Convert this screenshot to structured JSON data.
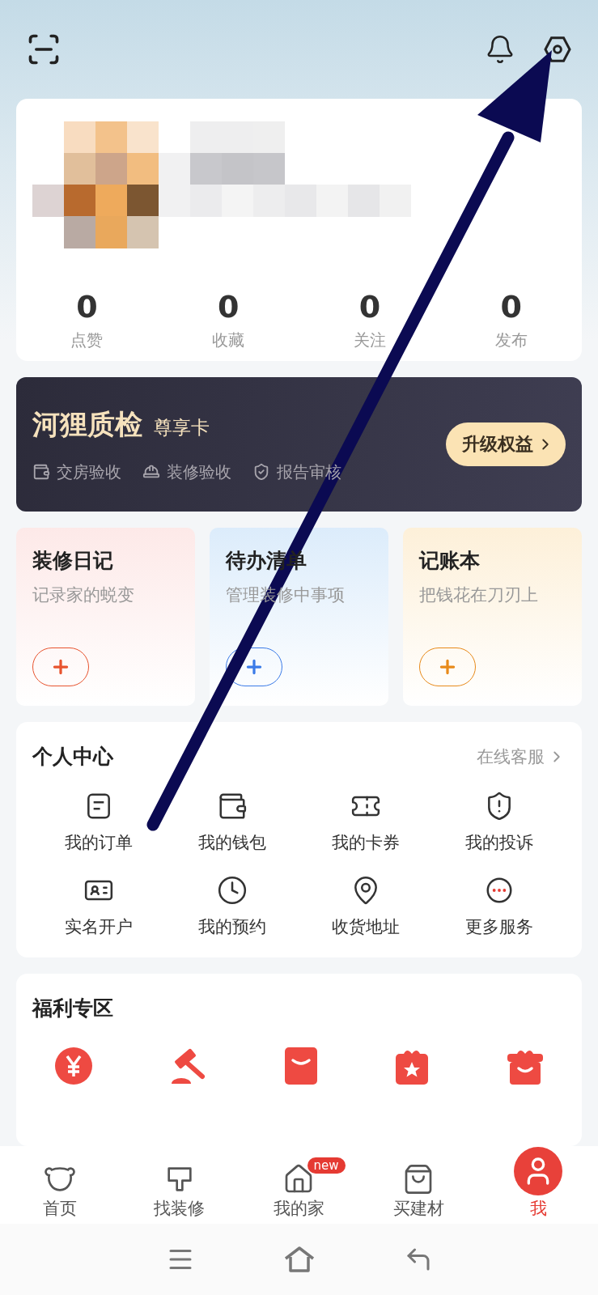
{
  "profile": {
    "stats": [
      {
        "value": "0",
        "label": "点赞"
      },
      {
        "value": "0",
        "label": "收藏"
      },
      {
        "value": "0",
        "label": "关注"
      },
      {
        "value": "0",
        "label": "发布"
      }
    ]
  },
  "vip_card": {
    "brand": "河狸质检",
    "tier": "尊享卡",
    "features": [
      "交房验收",
      "装修验收",
      "报告审核"
    ],
    "button": "升级权益"
  },
  "tools": [
    {
      "title": "装修日记",
      "subtitle": "记录家的蜕变",
      "color": "#e8542f"
    },
    {
      "title": "待办清单",
      "subtitle": "管理装修中事项",
      "color": "#3b7be8"
    },
    {
      "title": "记账本",
      "subtitle": "把钱花在刀刃上",
      "color": "#e88a1a"
    }
  ],
  "personal_center": {
    "title": "个人中心",
    "link": "在线客服",
    "items": [
      "我的订单",
      "我的钱包",
      "我的卡券",
      "我的投诉",
      "实名开户",
      "我的预约",
      "收货地址",
      "更多服务"
    ]
  },
  "welfare": {
    "title": "福利专区"
  },
  "nav": [
    {
      "label": "首页",
      "selected": false
    },
    {
      "label": "找装修",
      "selected": false
    },
    {
      "label": "我的家",
      "selected": false,
      "badge": "new"
    },
    {
      "label": "买建材",
      "selected": false
    },
    {
      "label": "我",
      "selected": true
    }
  ]
}
